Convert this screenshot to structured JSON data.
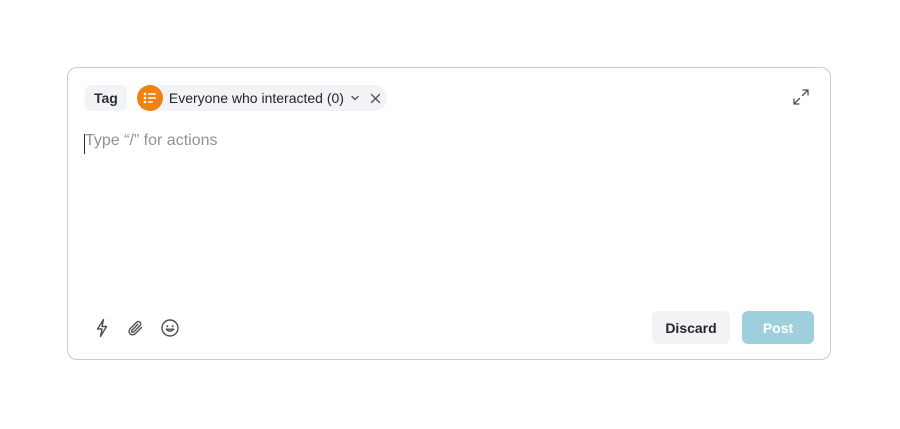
{
  "composer": {
    "tag_label": "Tag",
    "audience": {
      "label": "Everyone who interacted (0)",
      "icon": "list-icon",
      "icon_color": "#ee8312"
    },
    "editor": {
      "value": "",
      "placeholder": "Type “/” for actions"
    },
    "toolbar": {
      "icons": [
        "lightning-icon",
        "paperclip-icon",
        "emoji-icon"
      ]
    },
    "actions": {
      "discard_label": "Discard",
      "post_label": "Post",
      "post_color": "#9fcfda"
    }
  }
}
